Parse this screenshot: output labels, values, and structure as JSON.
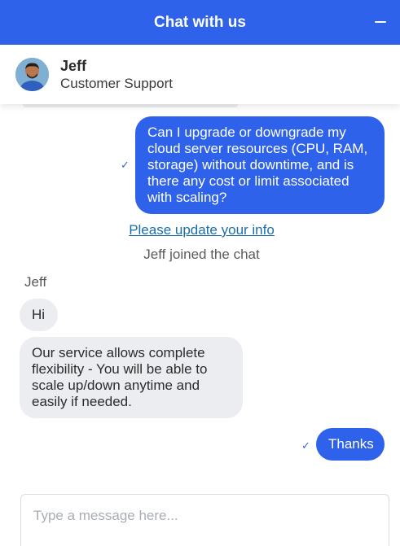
{
  "header": {
    "title": "Chat with us",
    "minimize_icon": "minus-icon",
    "bg_color": "#2f62ea"
  },
  "agent": {
    "name": "Jeff",
    "role": "Customer Support",
    "avatar_icon": "agent-avatar"
  },
  "messages": [
    {
      "sender": "user",
      "text": "Can I upgrade or downgrade my cloud server resources (CPU, RAM, storage) without downtime, and is there any cost or limit associated with scaling?",
      "status_icon": "check-icon"
    },
    {
      "sender": "agent",
      "text": "Hi"
    },
    {
      "sender": "agent",
      "text": "Our service allows complete flexibility - You will be able to scale up/down anytime and easily if needed."
    },
    {
      "sender": "user",
      "text": "Thanks",
      "status_icon": "check-icon"
    }
  ],
  "info_link": "Please update your info",
  "system_note": "Jeff joined the chat",
  "agent_label": "Jeff",
  "composer": {
    "placeholder": "Type a message here..."
  },
  "colors": {
    "accent": "#2f62ea",
    "incoming_bubble": "#ebedf0",
    "link": "#1a6ea8"
  }
}
